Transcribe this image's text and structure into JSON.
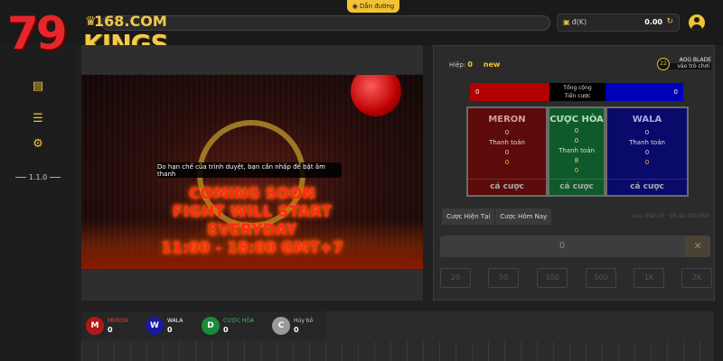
{
  "brand": {
    "number": "79",
    "domain": "168.COM",
    "name": "KINGS",
    "crown": "♛"
  },
  "topbar": {
    "guide_label": "Dẫn đường",
    "currency": "đ",
    "currency_unit": "(K)",
    "balance": "0.00"
  },
  "sidebar": {
    "version": "1.1.0"
  },
  "video": {
    "toast": "Do hạn chế của trình duyệt, bạn cần nhấp để bật âm thanh",
    "promo_lines": [
      "COMING SOON",
      "FIGHT WILL START",
      "EVERYDAY",
      "11:00 - 18:00 GMT+7"
    ]
  },
  "bet": {
    "round_label": "Hiệp:",
    "round_number": "0",
    "round_status": "new",
    "aog_badge": "22",
    "aog_name": "AOG BLADE",
    "aog_sub": "vào trò chơi",
    "total_left": "0",
    "total_label_1": "Tổng cộng",
    "total_label_2": "Tiền cược",
    "total_right": "0",
    "meron": {
      "title": "MERON",
      "v1": "0",
      "pay_label": "Thanh toán",
      "v2": "0",
      "v3": "0",
      "bet_label": "cá cược"
    },
    "draw": {
      "title": "CƯỢC HÒA",
      "v1": "0",
      "v2": "0",
      "pay_label": "Thanh toán",
      "v3": "8",
      "v4": "0",
      "bet_label": "cá cược"
    },
    "wala": {
      "title": "WALA",
      "v1": "0",
      "pay_label": "Thanh toán",
      "v2": "0",
      "v3": "0",
      "bet_label": "cá cược"
    },
    "tab_current": "Cược Hiện Tại",
    "tab_today": "Cược Hôm Nay",
    "limits": "cao nhất:20 · tối đa:100,000",
    "amount": "0",
    "clear": "✕",
    "chips": [
      "20",
      "50",
      "100",
      "500",
      "1K",
      "2K"
    ]
  },
  "stats": [
    {
      "letter": "M",
      "label": "MERON",
      "value": "0",
      "color": "#b01818",
      "label_color": "#e04040"
    },
    {
      "letter": "W",
      "label": "WALA",
      "value": "0",
      "color": "#1a1aa0",
      "label_color": "#ffffff"
    },
    {
      "letter": "D",
      "label": "CƯỢC HÒA",
      "value": "0",
      "color": "#1d8a3a",
      "label_color": "#3ec060"
    },
    {
      "letter": "C",
      "label": "Hủy bỏ",
      "value": "0",
      "color": "#9a9a9a",
      "label_color": "#cccccc"
    }
  ]
}
